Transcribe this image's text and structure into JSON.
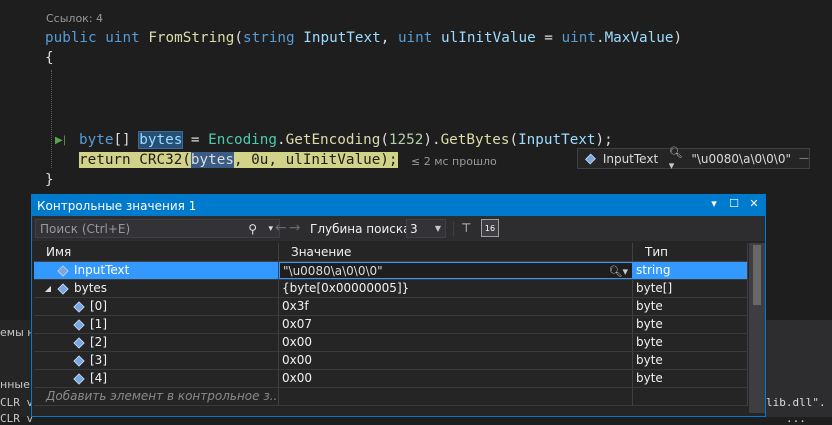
{
  "editor": {
    "codelens": "Ссылок: 4",
    "signature": {
      "kw1": "public",
      "kw2": "uint",
      "method": "FromString",
      "paren_open": "(",
      "p1_type": "string",
      "p1_name": "InputText",
      "comma": ", ",
      "p2_type": "uint",
      "p2_name": "ulInitValue",
      "eq": " = ",
      "p2_default_type": "uint",
      "dot": ".",
      "p2_default_member": "MaxValue",
      "paren_close": ")"
    },
    "brace_open": "{",
    "brace_close": "}",
    "line1": {
      "type": "byte",
      "brackets": "[] ",
      "var": "bytes",
      "eq": " = ",
      "cls": "Encoding",
      "dot1": ".",
      "m1": "GetEncoding",
      "lp1": "(",
      "num": "1252",
      "rp1": ").",
      "m2": "GetBytes",
      "lp2": "(",
      "arg": "InputText",
      "end": ");"
    },
    "line2": {
      "kw": "return ",
      "fn": "CRC32(",
      "arg1": "bytes",
      "rest": ", 0u, ulInitValue);"
    },
    "perf_tip": "≤ 2 мс прошло"
  },
  "datatip": {
    "name": "InputText",
    "value": "\"\\u0080\\a\\0\\0\\0\""
  },
  "watch": {
    "title": "Контрольные значения 1",
    "search_placeholder": "Поиск (Ctrl+E)",
    "depth_label": "Глубина поиска:",
    "depth_value": "3",
    "columns": {
      "name": "Имя",
      "value": "Значение",
      "type": "Тип"
    },
    "rows": [
      {
        "name": "InputText",
        "value": "\"\\u0080\\a\\0\\0\\0\"",
        "type": "string"
      },
      {
        "name": "bytes",
        "value": "{byte[0x00000005]}",
        "type": "byte[]"
      },
      {
        "name": "[0]",
        "value": "0x3f",
        "type": "byte"
      },
      {
        "name": "[1]",
        "value": "0x07",
        "type": "byte"
      },
      {
        "name": "[2]",
        "value": "0x00",
        "type": "byte"
      },
      {
        "name": "[3]",
        "value": "0x00",
        "type": "byte"
      },
      {
        "name": "[4]",
        "value": "0x00",
        "type": "byte"
      }
    ],
    "add_placeholder": "Добавить элемент в контрольное з..."
  },
  "background": {
    "frag1": "емы н",
    "frag2": "нные и",
    "frag3": "CLR v",
    "frag4": "CLR v",
    "frag_right1": "lib.dll\".",
    "frag_right2": "..."
  },
  "colors": {
    "accent": "#007acc",
    "selection": "#3399ff",
    "editor_bg": "#1e1e1e",
    "keyword": "#569cd6",
    "type": "#4ec9b0",
    "statement_highlight": "#d2d288"
  }
}
